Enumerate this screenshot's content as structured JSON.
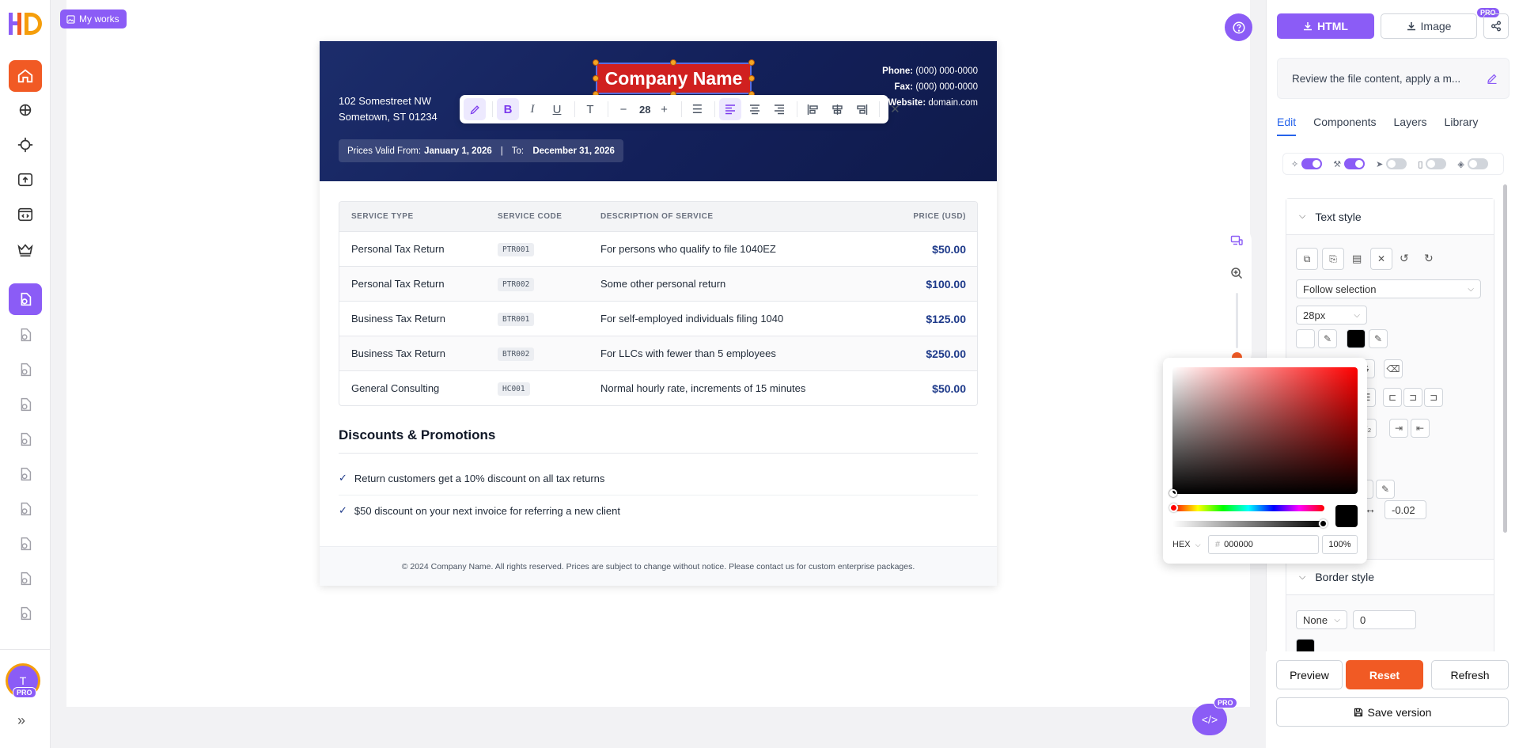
{
  "app": {
    "logo_text": "HD",
    "avatar_initial": "T",
    "avatar_badge": "PRO"
  },
  "header": {
    "my_works_label": "My works"
  },
  "document": {
    "company_name": "Company Name",
    "address_line1": "102 Somestreet NW",
    "address_line2": "Sometown, ST 01234",
    "phone_label": "Phone:",
    "phone_value": "(000) 000-0000",
    "fax_label": "Fax:",
    "fax_value": "(000) 000-0000",
    "website_label": "Website:",
    "website_value": "domain.com",
    "valid_from_label": "Prices Valid From:",
    "valid_from_value": "January 1, 2026",
    "valid_sep": "|",
    "valid_to_label": "To:",
    "valid_to_value": "December 31, 2026",
    "table": {
      "headers": [
        "SERVICE TYPE",
        "SERVICE CODE",
        "DESCRIPTION OF SERVICE",
        "PRICE (USD)"
      ],
      "rows": [
        {
          "type": "Personal Tax Return",
          "code": "PTR001",
          "desc": "For persons who qualify to file 1040EZ",
          "price": "$50.00"
        },
        {
          "type": "Personal Tax Return",
          "code": "PTR002",
          "desc": "Some other personal return",
          "price": "$100.00"
        },
        {
          "type": "Business Tax Return",
          "code": "BTR001",
          "desc": "For self-employed individuals filing 1040",
          "price": "$125.00"
        },
        {
          "type": "Business Tax Return",
          "code": "BTR002",
          "desc": "For LLCs with fewer than 5 employees",
          "price": "$250.00"
        },
        {
          "type": "General Consulting",
          "code": "HC001",
          "desc": "Normal hourly rate, increments of 15 minutes",
          "price": "$50.00"
        }
      ]
    },
    "discounts_title": "Discounts & Promotions",
    "discounts": [
      "Return customers get a 10% discount on all tax returns",
      "$50 discount on your next invoice for referring a new client"
    ],
    "footer": "© 2024 Company Name. All rights reserved. Prices are subject to change without notice. Please contact us for custom enterprise packages."
  },
  "text_toolbar": {
    "font_size": "28"
  },
  "color_picker": {
    "format": "HEX",
    "hex_value": "000000",
    "opacity": "100%",
    "current_color": "#000000"
  },
  "fab": {
    "pro_badge": "PRO"
  },
  "right_panel": {
    "html_label": "HTML",
    "image_label": "Image",
    "pro_badge": "PRO",
    "prompt_text": "Review the file content, apply a m...",
    "tabs": [
      "Edit",
      "Components",
      "Layers",
      "Library"
    ],
    "active_tab": "Edit",
    "text_style_title": "Text style",
    "follow_selection": "Follow selection",
    "font_size_value": "28px",
    "letter_spacing_value": "-0.02",
    "border_style_title": "Border style",
    "border_type": "None",
    "border_width": "0",
    "preview_label": "Preview",
    "reset_label": "Reset",
    "refresh_label": "Refresh",
    "save_version_label": "Save version"
  },
  "colors": {
    "accent_purple": "#8b5cf6",
    "accent_orange": "#f15a24",
    "header_navy": "#13205a",
    "price_blue": "#1e3a8a",
    "company_red": "#d0201f"
  }
}
